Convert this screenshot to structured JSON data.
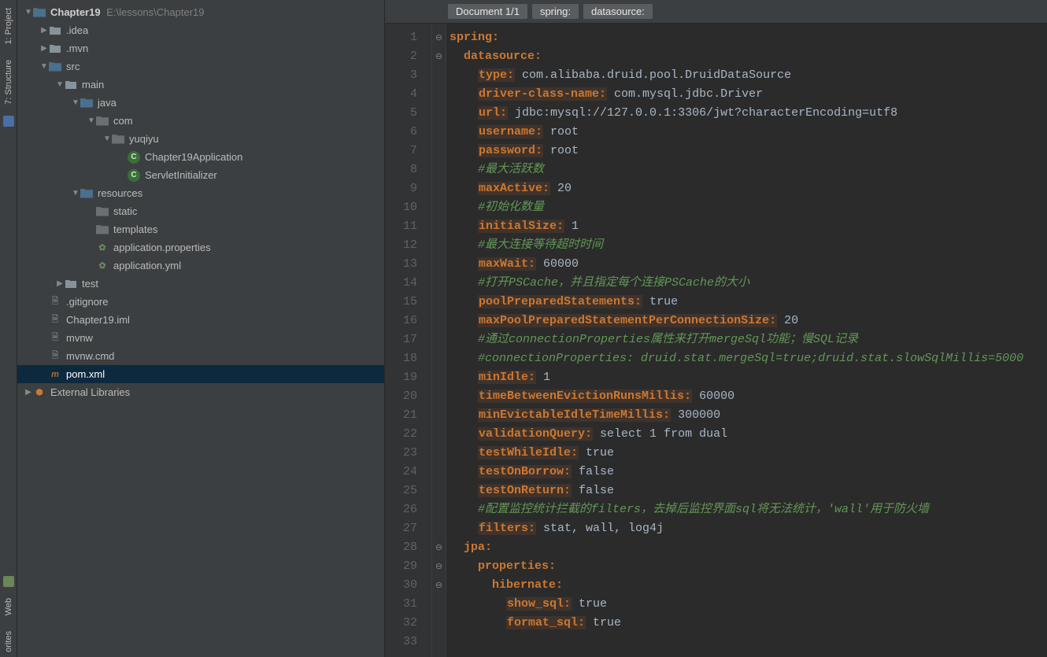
{
  "tool_tabs": {
    "project": "1: Project",
    "structure": "7: Structure",
    "web": "Web",
    "favorites": "orites"
  },
  "project": {
    "root": {
      "name": "Chapter19",
      "path": "E:\\lessons\\Chapter19"
    },
    "tree": [
      {
        "depth": 0,
        "arrow": "▼",
        "icon": "module",
        "label": "Chapter19",
        "bold": true,
        "path": "E:\\lessons\\Chapter19"
      },
      {
        "depth": 1,
        "arrow": "▶",
        "icon": "folder",
        "label": ".idea"
      },
      {
        "depth": 1,
        "arrow": "▶",
        "icon": "folder",
        "label": ".mvn"
      },
      {
        "depth": 1,
        "arrow": "▼",
        "icon": "src",
        "label": "src"
      },
      {
        "depth": 2,
        "arrow": "▼",
        "icon": "folder",
        "label": "main"
      },
      {
        "depth": 3,
        "arrow": "▼",
        "icon": "src",
        "label": "java"
      },
      {
        "depth": 4,
        "arrow": "▼",
        "icon": "pkg",
        "label": "com"
      },
      {
        "depth": 5,
        "arrow": "▼",
        "icon": "pkg",
        "label": "yuqiyu"
      },
      {
        "depth": 6,
        "arrow": "",
        "icon": "class",
        "label": "Chapter19Application"
      },
      {
        "depth": 6,
        "arrow": "",
        "icon": "class",
        "label": "ServletInitializer"
      },
      {
        "depth": 3,
        "arrow": "▼",
        "icon": "src",
        "label": "resources"
      },
      {
        "depth": 4,
        "arrow": "",
        "icon": "pkg",
        "label": "static"
      },
      {
        "depth": 4,
        "arrow": "",
        "icon": "pkg",
        "label": "templates"
      },
      {
        "depth": 4,
        "arrow": "",
        "icon": "prop",
        "label": "application.properties"
      },
      {
        "depth": 4,
        "arrow": "",
        "icon": "yml",
        "label": "application.yml"
      },
      {
        "depth": 2,
        "arrow": "▶",
        "icon": "folder",
        "label": "test"
      },
      {
        "depth": 1,
        "arrow": "",
        "icon": "file",
        "label": ".gitignore"
      },
      {
        "depth": 1,
        "arrow": "",
        "icon": "file",
        "label": "Chapter19.iml"
      },
      {
        "depth": 1,
        "arrow": "",
        "icon": "file",
        "label": "mvnw"
      },
      {
        "depth": 1,
        "arrow": "",
        "icon": "file",
        "label": "mvnw.cmd"
      },
      {
        "depth": 1,
        "arrow": "",
        "icon": "xml",
        "label": "pom.xml",
        "selected": true
      },
      {
        "depth": 0,
        "arrow": "▶",
        "icon": "lib",
        "label": "External Libraries"
      }
    ]
  },
  "breadcrumb": {
    "doc": "Document 1/1",
    "path": [
      "spring:",
      "datasource:"
    ]
  },
  "editor": {
    "lines": [
      {
        "n": 1,
        "fold": "⊖",
        "indent": 0,
        "segs": [
          {
            "t": "spring:",
            "c": "keyplain"
          }
        ]
      },
      {
        "n": 2,
        "fold": "⊖",
        "indent": 1,
        "segs": [
          {
            "t": "datasource:",
            "c": "keyplain"
          }
        ]
      },
      {
        "n": 3,
        "fold": "",
        "indent": 2,
        "segs": [
          {
            "t": "type:",
            "c": "key"
          },
          {
            "t": " com.alibaba.druid.pool.DruidDataSource",
            "c": "val"
          }
        ]
      },
      {
        "n": 4,
        "fold": "",
        "indent": 2,
        "segs": [
          {
            "t": "driver-class-name:",
            "c": "key"
          },
          {
            "t": " com.mysql.jdbc.Driver",
            "c": "val"
          }
        ]
      },
      {
        "n": 5,
        "fold": "",
        "indent": 2,
        "segs": [
          {
            "t": "url:",
            "c": "key"
          },
          {
            "t": " jdbc:mysql://127.0.0.1:3306/jwt?characterEncoding=utf8",
            "c": "val"
          }
        ]
      },
      {
        "n": 6,
        "fold": "",
        "indent": 2,
        "segs": [
          {
            "t": "username:",
            "c": "key"
          },
          {
            "t": " root",
            "c": "val"
          }
        ]
      },
      {
        "n": 7,
        "fold": "",
        "indent": 2,
        "segs": [
          {
            "t": "password:",
            "c": "key"
          },
          {
            "t": " root",
            "c": "val"
          }
        ]
      },
      {
        "n": 8,
        "fold": "",
        "indent": 2,
        "segs": [
          {
            "t": "#最大活跃数",
            "c": "cmt"
          }
        ]
      },
      {
        "n": 9,
        "fold": "",
        "indent": 2,
        "segs": [
          {
            "t": "maxActive:",
            "c": "key"
          },
          {
            "t": " 20",
            "c": "val"
          }
        ]
      },
      {
        "n": 10,
        "fold": "",
        "indent": 2,
        "segs": [
          {
            "t": "#初始化数量",
            "c": "cmt"
          }
        ]
      },
      {
        "n": 11,
        "fold": "",
        "indent": 2,
        "segs": [
          {
            "t": "initialSize:",
            "c": "key"
          },
          {
            "t": " 1",
            "c": "val"
          }
        ]
      },
      {
        "n": 12,
        "fold": "",
        "indent": 2,
        "segs": [
          {
            "t": "#最大连接等待超时时间",
            "c": "cmt"
          }
        ]
      },
      {
        "n": 13,
        "fold": "",
        "indent": 2,
        "segs": [
          {
            "t": "maxWait:",
            "c": "key"
          },
          {
            "t": " 60000",
            "c": "val"
          }
        ]
      },
      {
        "n": 14,
        "fold": "",
        "indent": 2,
        "segs": [
          {
            "t": "#打开PSCache，并且指定每个连接PSCache的大小",
            "c": "cmt"
          }
        ]
      },
      {
        "n": 15,
        "fold": "",
        "indent": 2,
        "segs": [
          {
            "t": "poolPreparedStatements:",
            "c": "key"
          },
          {
            "t": " true",
            "c": "val"
          }
        ]
      },
      {
        "n": 16,
        "fold": "",
        "indent": 2,
        "segs": [
          {
            "t": "maxPoolPreparedStatementPerConnectionSize:",
            "c": "key"
          },
          {
            "t": " 20",
            "c": "val"
          }
        ]
      },
      {
        "n": 17,
        "fold": "",
        "indent": 2,
        "segs": [
          {
            "t": "#通过connectionProperties属性来打开mergeSql功能；慢SQL记录",
            "c": "cmt"
          }
        ]
      },
      {
        "n": 18,
        "fold": "",
        "indent": 2,
        "segs": [
          {
            "t": "#connectionProperties: druid.stat.mergeSql=true;druid.stat.slowSqlMillis=5000",
            "c": "cmt"
          }
        ]
      },
      {
        "n": 19,
        "fold": "",
        "indent": 2,
        "segs": [
          {
            "t": "minIdle:",
            "c": "key"
          },
          {
            "t": " 1",
            "c": "val"
          }
        ]
      },
      {
        "n": 20,
        "fold": "",
        "indent": 2,
        "segs": [
          {
            "t": "timeBetweenEvictionRunsMillis:",
            "c": "key"
          },
          {
            "t": " 60000",
            "c": "val"
          }
        ]
      },
      {
        "n": 21,
        "fold": "",
        "indent": 2,
        "segs": [
          {
            "t": "minEvictableIdleTimeMillis:",
            "c": "key"
          },
          {
            "t": " 300000",
            "c": "val"
          }
        ]
      },
      {
        "n": 22,
        "fold": "",
        "indent": 2,
        "segs": [
          {
            "t": "validationQuery:",
            "c": "key"
          },
          {
            "t": " select 1 from dual",
            "c": "val"
          }
        ]
      },
      {
        "n": 23,
        "fold": "",
        "indent": 2,
        "segs": [
          {
            "t": "testWhileIdle:",
            "c": "key"
          },
          {
            "t": " true",
            "c": "val"
          }
        ]
      },
      {
        "n": 24,
        "fold": "",
        "indent": 2,
        "segs": [
          {
            "t": "testOnBorrow:",
            "c": "key"
          },
          {
            "t": " false",
            "c": "val"
          }
        ]
      },
      {
        "n": 25,
        "fold": "",
        "indent": 2,
        "segs": [
          {
            "t": "testOnReturn:",
            "c": "key"
          },
          {
            "t": " false",
            "c": "val"
          }
        ]
      },
      {
        "n": 26,
        "fold": "",
        "indent": 2,
        "segs": [
          {
            "t": "#配置监控统计拦截的filters，去掉后监控界面sql将无法统计，'wall'用于防火墙",
            "c": "cmt"
          }
        ]
      },
      {
        "n": 27,
        "fold": "",
        "indent": 2,
        "segs": [
          {
            "t": "filters:",
            "c": "key"
          },
          {
            "t": " stat, wall, log4j",
            "c": "val"
          }
        ]
      },
      {
        "n": 28,
        "fold": "⊖",
        "indent": 1,
        "segs": [
          {
            "t": "jpa:",
            "c": "keyplain"
          }
        ]
      },
      {
        "n": 29,
        "fold": "⊖",
        "indent": 2,
        "segs": [
          {
            "t": "properties:",
            "c": "keyplain"
          }
        ]
      },
      {
        "n": 30,
        "fold": "⊖",
        "indent": 3,
        "segs": [
          {
            "t": "hibernate:",
            "c": "keyplain"
          }
        ]
      },
      {
        "n": 31,
        "fold": "",
        "indent": 4,
        "segs": [
          {
            "t": "show_sql:",
            "c": "key"
          },
          {
            "t": " true",
            "c": "val"
          }
        ]
      },
      {
        "n": 32,
        "fold": "",
        "indent": 4,
        "segs": [
          {
            "t": "format_sql:",
            "c": "key"
          },
          {
            "t": " true",
            "c": "val"
          }
        ]
      },
      {
        "n": 33,
        "fold": "",
        "indent": 0,
        "segs": []
      }
    ]
  }
}
